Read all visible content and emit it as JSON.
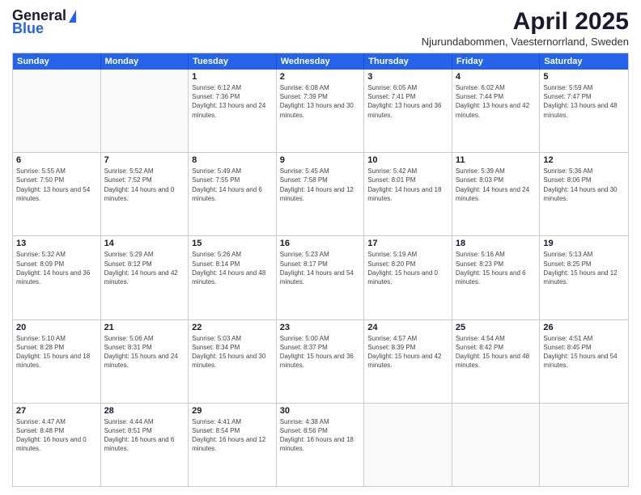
{
  "logo": {
    "general": "General",
    "blue": "Blue"
  },
  "title": "April 2025",
  "subtitle": "Njurundabommen, Vaesternorrland, Sweden",
  "header": {
    "days": [
      "Sunday",
      "Monday",
      "Tuesday",
      "Wednesday",
      "Thursday",
      "Friday",
      "Saturday"
    ]
  },
  "weeks": [
    [
      {
        "date": "",
        "sunrise": "",
        "sunset": "",
        "daylight": ""
      },
      {
        "date": "",
        "sunrise": "",
        "sunset": "",
        "daylight": ""
      },
      {
        "date": "1",
        "sunrise": "Sunrise: 6:12 AM",
        "sunset": "Sunset: 7:36 PM",
        "daylight": "Daylight: 13 hours and 24 minutes."
      },
      {
        "date": "2",
        "sunrise": "Sunrise: 6:08 AM",
        "sunset": "Sunset: 7:39 PM",
        "daylight": "Daylight: 13 hours and 30 minutes."
      },
      {
        "date": "3",
        "sunrise": "Sunrise: 6:05 AM",
        "sunset": "Sunset: 7:41 PM",
        "daylight": "Daylight: 13 hours and 36 minutes."
      },
      {
        "date": "4",
        "sunrise": "Sunrise: 6:02 AM",
        "sunset": "Sunset: 7:44 PM",
        "daylight": "Daylight: 13 hours and 42 minutes."
      },
      {
        "date": "5",
        "sunrise": "Sunrise: 5:59 AM",
        "sunset": "Sunset: 7:47 PM",
        "daylight": "Daylight: 13 hours and 48 minutes."
      }
    ],
    [
      {
        "date": "6",
        "sunrise": "Sunrise: 5:55 AM",
        "sunset": "Sunset: 7:50 PM",
        "daylight": "Daylight: 13 hours and 54 minutes."
      },
      {
        "date": "7",
        "sunrise": "Sunrise: 5:52 AM",
        "sunset": "Sunset: 7:52 PM",
        "daylight": "Daylight: 14 hours and 0 minutes."
      },
      {
        "date": "8",
        "sunrise": "Sunrise: 5:49 AM",
        "sunset": "Sunset: 7:55 PM",
        "daylight": "Daylight: 14 hours and 6 minutes."
      },
      {
        "date": "9",
        "sunrise": "Sunrise: 5:45 AM",
        "sunset": "Sunset: 7:58 PM",
        "daylight": "Daylight: 14 hours and 12 minutes."
      },
      {
        "date": "10",
        "sunrise": "Sunrise: 5:42 AM",
        "sunset": "Sunset: 8:01 PM",
        "daylight": "Daylight: 14 hours and 18 minutes."
      },
      {
        "date": "11",
        "sunrise": "Sunrise: 5:39 AM",
        "sunset": "Sunset: 8:03 PM",
        "daylight": "Daylight: 14 hours and 24 minutes."
      },
      {
        "date": "12",
        "sunrise": "Sunrise: 5:36 AM",
        "sunset": "Sunset: 8:06 PM",
        "daylight": "Daylight: 14 hours and 30 minutes."
      }
    ],
    [
      {
        "date": "13",
        "sunrise": "Sunrise: 5:32 AM",
        "sunset": "Sunset: 8:09 PM",
        "daylight": "Daylight: 14 hours and 36 minutes."
      },
      {
        "date": "14",
        "sunrise": "Sunrise: 5:29 AM",
        "sunset": "Sunset: 8:12 PM",
        "daylight": "Daylight: 14 hours and 42 minutes."
      },
      {
        "date": "15",
        "sunrise": "Sunrise: 5:26 AM",
        "sunset": "Sunset: 8:14 PM",
        "daylight": "Daylight: 14 hours and 48 minutes."
      },
      {
        "date": "16",
        "sunrise": "Sunrise: 5:23 AM",
        "sunset": "Sunset: 8:17 PM",
        "daylight": "Daylight: 14 hours and 54 minutes."
      },
      {
        "date": "17",
        "sunrise": "Sunrise: 5:19 AM",
        "sunset": "Sunset: 8:20 PM",
        "daylight": "Daylight: 15 hours and 0 minutes."
      },
      {
        "date": "18",
        "sunrise": "Sunrise: 5:16 AM",
        "sunset": "Sunset: 8:23 PM",
        "daylight": "Daylight: 15 hours and 6 minutes."
      },
      {
        "date": "19",
        "sunrise": "Sunrise: 5:13 AM",
        "sunset": "Sunset: 8:25 PM",
        "daylight": "Daylight: 15 hours and 12 minutes."
      }
    ],
    [
      {
        "date": "20",
        "sunrise": "Sunrise: 5:10 AM",
        "sunset": "Sunset: 8:28 PM",
        "daylight": "Daylight: 15 hours and 18 minutes."
      },
      {
        "date": "21",
        "sunrise": "Sunrise: 5:06 AM",
        "sunset": "Sunset: 8:31 PM",
        "daylight": "Daylight: 15 hours and 24 minutes."
      },
      {
        "date": "22",
        "sunrise": "Sunrise: 5:03 AM",
        "sunset": "Sunset: 8:34 PM",
        "daylight": "Daylight: 15 hours and 30 minutes."
      },
      {
        "date": "23",
        "sunrise": "Sunrise: 5:00 AM",
        "sunset": "Sunset: 8:37 PM",
        "daylight": "Daylight: 15 hours and 36 minutes."
      },
      {
        "date": "24",
        "sunrise": "Sunrise: 4:57 AM",
        "sunset": "Sunset: 8:39 PM",
        "daylight": "Daylight: 15 hours and 42 minutes."
      },
      {
        "date": "25",
        "sunrise": "Sunrise: 4:54 AM",
        "sunset": "Sunset: 8:42 PM",
        "daylight": "Daylight: 15 hours and 48 minutes."
      },
      {
        "date": "26",
        "sunrise": "Sunrise: 4:51 AM",
        "sunset": "Sunset: 8:45 PM",
        "daylight": "Daylight: 15 hours and 54 minutes."
      }
    ],
    [
      {
        "date": "27",
        "sunrise": "Sunrise: 4:47 AM",
        "sunset": "Sunset: 8:48 PM",
        "daylight": "Daylight: 16 hours and 0 minutes."
      },
      {
        "date": "28",
        "sunrise": "Sunrise: 4:44 AM",
        "sunset": "Sunset: 8:51 PM",
        "daylight": "Daylight: 16 hours and 6 minutes."
      },
      {
        "date": "29",
        "sunrise": "Sunrise: 4:41 AM",
        "sunset": "Sunset: 8:54 PM",
        "daylight": "Daylight: 16 hours and 12 minutes."
      },
      {
        "date": "30",
        "sunrise": "Sunrise: 4:38 AM",
        "sunset": "Sunset: 8:56 PM",
        "daylight": "Daylight: 16 hours and 18 minutes."
      },
      {
        "date": "",
        "sunrise": "",
        "sunset": "",
        "daylight": ""
      },
      {
        "date": "",
        "sunrise": "",
        "sunset": "",
        "daylight": ""
      },
      {
        "date": "",
        "sunrise": "",
        "sunset": "",
        "daylight": ""
      }
    ]
  ]
}
